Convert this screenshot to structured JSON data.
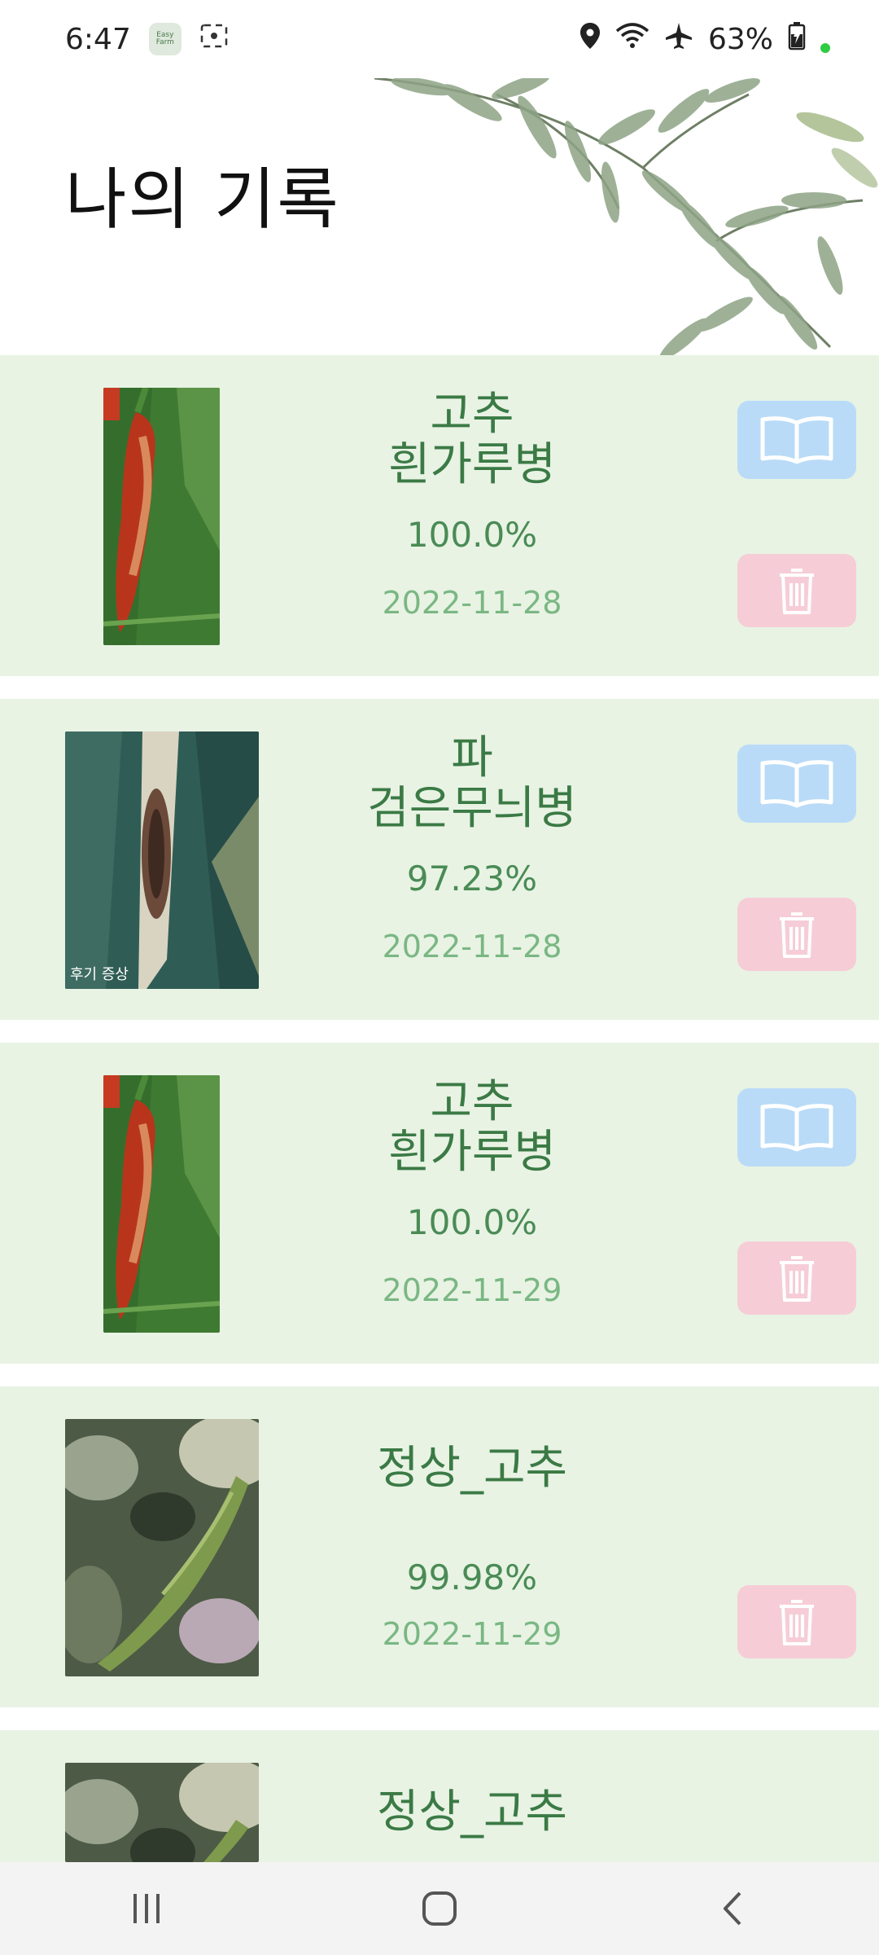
{
  "status": {
    "time": "6:47",
    "app_badge_text": "Easy Farm",
    "battery": "63%"
  },
  "header": {
    "title": "나의 기록"
  },
  "records": [
    {
      "crop": "고추",
      "disease": "흰가루병",
      "confidence": "100.0%",
      "date": "2022-11-28",
      "has_info": true,
      "image": "red-pepper-photo",
      "caption": ""
    },
    {
      "crop": "파",
      "disease": "검은무늬병",
      "confidence": "97.23%",
      "date": "2022-11-28",
      "has_info": true,
      "image": "green-onion-leaf-photo",
      "caption": "후기 증상"
    },
    {
      "crop": "고추",
      "disease": "흰가루병",
      "confidence": "100.0%",
      "date": "2022-11-29",
      "has_info": true,
      "image": "red-pepper-photo",
      "caption": ""
    },
    {
      "name": "정상_고추",
      "confidence": "99.98%",
      "date": "2022-11-29",
      "has_info": false,
      "image": "green-pepper-photo",
      "caption": ""
    },
    {
      "name": "정상_고추",
      "confidence": "",
      "date": "",
      "has_info": false,
      "image": "green-pepper-photo",
      "caption": ""
    }
  ],
  "colors": {
    "card_bg": "#e8f3e4",
    "text_green": "#3b7a45",
    "date_green": "#7ab783",
    "book_btn": "#b9dbf7",
    "trash_btn": "#f6cdd6"
  },
  "icons": {
    "book": "book-open-icon",
    "trash": "trash-icon",
    "nav_recent": "recent-apps-icon",
    "nav_home": "home-icon",
    "nav_back": "back-icon"
  }
}
